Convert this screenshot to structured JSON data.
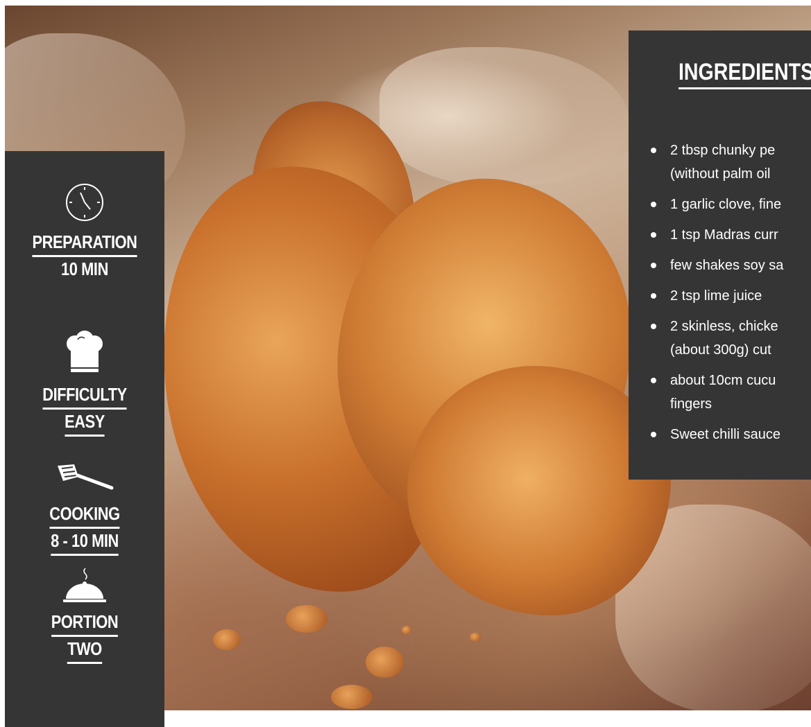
{
  "info": {
    "preparation": {
      "label": "PREPARATION",
      "value": "10 MIN",
      "icon": "clock-icon"
    },
    "difficulty": {
      "label": "DIFFICULTY",
      "value": "EASY",
      "icon": "chef-hat-icon"
    },
    "cooking": {
      "label": "COOKING",
      "value": "8 - 10 MIN",
      "icon": "spatula-icon"
    },
    "portion": {
      "label": "PORTION",
      "value": "TWO",
      "icon": "cloche-icon"
    }
  },
  "ingredients": {
    "title": "INGREDIENTS",
    "items": [
      {
        "line1": "2 tbsp chunky pe",
        "line2": "(without palm oil"
      },
      {
        "line1": "1 garlic clove, fine"
      },
      {
        "line1": "1 tsp Madras curr"
      },
      {
        "line1": "few shakes soy sa"
      },
      {
        "line1": "2 tsp lime juice"
      },
      {
        "line1": "2 skinless, chicke",
        "line2": "(about 300g) cut"
      },
      {
        "line1": "about 10cm cucu",
        "line2": "fingers"
      },
      {
        "line1": "Sweet chilli sauce"
      }
    ]
  },
  "colors": {
    "panel": "#353535",
    "text": "#ffffff"
  }
}
